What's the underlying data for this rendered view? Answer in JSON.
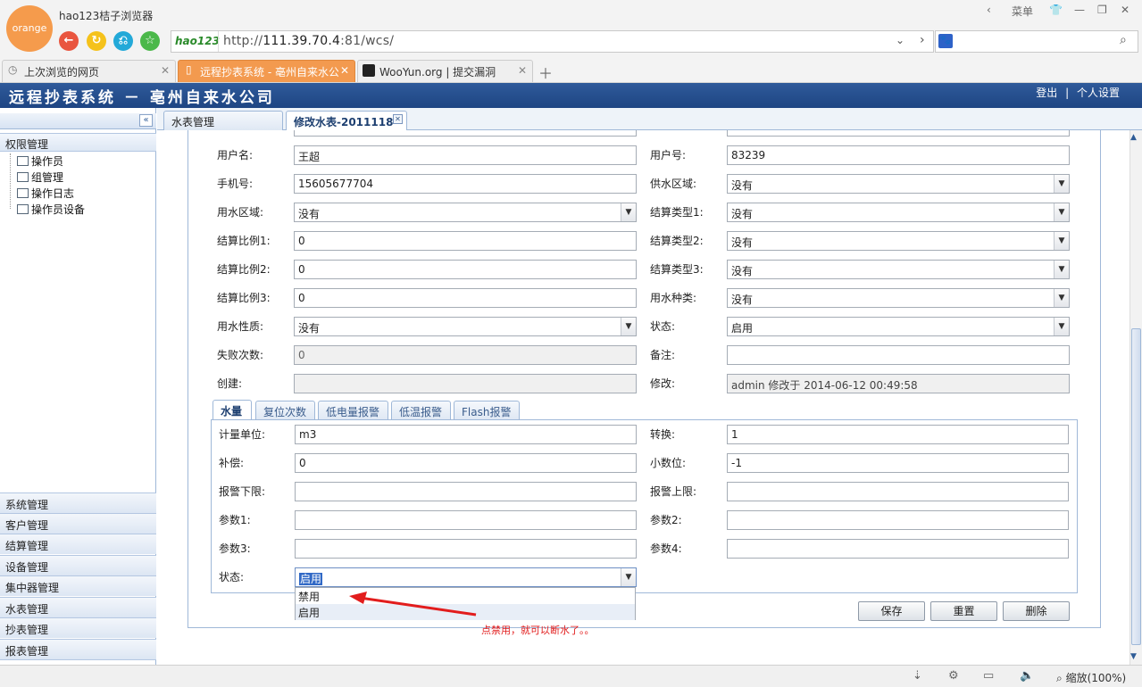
{
  "browser": {
    "logo_text": "orange",
    "name": "hao123桔子浏览器",
    "url_brand": "hao123",
    "url_prefix": "http://",
    "url_host": "111.39.70.4",
    "url_rest": ":81/wcs/",
    "menu_label": "菜单",
    "tabs": [
      {
        "label": "上次浏览的网页"
      },
      {
        "label": "远程抄表系统 - 亳州自来水公"
      },
      {
        "label": "WooYun.org | 提交漏洞"
      }
    ],
    "zoom_label": "缩放(100%)"
  },
  "app": {
    "title": "远程抄表系统 － 亳州自来水公司",
    "logout": "登出",
    "separator": "|",
    "settings": "个人设置"
  },
  "sidebar": {
    "section_title": "权限管理",
    "tree_items": [
      "操作员",
      "组管理",
      "操作日志",
      "操作员设备"
    ],
    "accordion": [
      "系统管理",
      "客户管理",
      "结算管理",
      "设备管理",
      "集中器管理",
      "水表管理",
      "抄表管理",
      "报表管理"
    ]
  },
  "content_tabs": [
    "水表管理",
    "修改水表-2011118"
  ],
  "form": {
    "username_label": "用户名:",
    "username": "王超",
    "userno_label": "用户号:",
    "userno": "83239",
    "phone_label": "手机号:",
    "phone": "15605677704",
    "supply_area_label": "供水区域:",
    "supply_area": "没有",
    "water_area_label": "用水区域:",
    "water_area": "没有",
    "settle_type1_label": "结算类型1:",
    "settle_type1": "没有",
    "settle_ratio1_label": "结算比例1:",
    "settle_ratio1": "0",
    "settle_type2_label": "结算类型2:",
    "settle_type2": "没有",
    "settle_ratio2_label": "结算比例2:",
    "settle_ratio2": "0",
    "settle_type3_label": "结算类型3:",
    "settle_type3": "没有",
    "settle_ratio3_label": "结算比例3:",
    "settle_ratio3": "0",
    "water_kind_label": "用水种类:",
    "water_kind": "没有",
    "water_nature_label": "用水性质:",
    "water_nature": "没有",
    "status_label": "状态:",
    "status": "启用",
    "fail_count_label": "失败次数:",
    "fail_count": "0",
    "remark_label": "备注:",
    "remark": "",
    "created_label": "创建:",
    "created": "",
    "modified_label": "修改:",
    "modified": "admin 修改于 2014-06-12 00:49:58"
  },
  "inner_tabs": [
    "水量",
    "复位次数",
    "低电量报警",
    "低温报警",
    "Flash报警"
  ],
  "inner_form": {
    "unit_label": "计量单位:",
    "unit": "m3",
    "convert_label": "转换:",
    "convert": "1",
    "comp_label": "补偿:",
    "comp": "0",
    "decimal_label": "小数位:",
    "decimal": "-1",
    "alarm_low_label": "报警下限:",
    "alarm_low": "",
    "alarm_high_label": "报警上限:",
    "alarm_high": "",
    "param1_label": "参数1:",
    "param1": "",
    "param2_label": "参数2:",
    "param2": "",
    "param3_label": "参数3:",
    "param3": "",
    "param4_label": "参数4:",
    "param4": "",
    "status_label": "状态:",
    "status": "启用",
    "status_options": [
      "禁用",
      "启用"
    ]
  },
  "buttons": {
    "save": "保存",
    "reset": "重置",
    "delete": "删除"
  },
  "annotation": "点禁用，就可以断水了。。",
  "colors": {
    "header": "#1e4583",
    "accent_orange": "#f39a4f",
    "annotation_red": "#e21d1d"
  }
}
